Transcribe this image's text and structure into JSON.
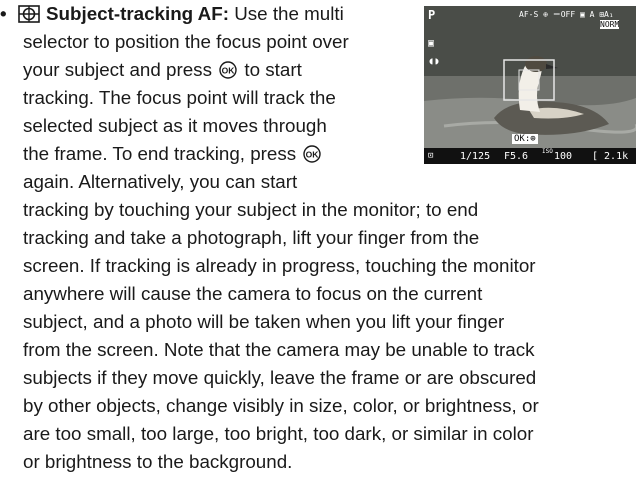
{
  "bullet": {
    "symbol": "•",
    "af_icon": "subject-tracking-af-icon",
    "title": "Subject-tracking AF",
    "title_suffix": ":",
    "ok_icon": "ok-button-icon"
  },
  "lines": [
    " Use the multi",
    "selector to position the focus point over",
    "your subject and press",
    " to start",
    "tracking. The focus point will track the",
    "selected subject as it moves through",
    "the frame. To end tracking, press",
    "again. Alternatively, you can start",
    "tracking by touching your subject in the monitor; to end",
    "tracking and take a photograph, lift your finger from the",
    "screen. If tracking is already in progress, touching the monitor",
    "anywhere will cause the camera to focus on the current",
    "subject, and a photo will be taken when you lift your finger",
    "from the screen. Note that the camera may be unable to track",
    "subjects if they move quickly, leave the frame or are obscured",
    "by other objects, change visibly in size, color, or brightness, or",
    "are too small, too large, too bright, too dark, or similar in color",
    "or brightness to the background."
  ],
  "camera_display": {
    "mode": "P",
    "top_icons": "AF-S ⊕ ＝OFF ▣ A ⊞A₁",
    "picture_control": "NORM",
    "ok_hint": "OK:",
    "shutter": "1/125",
    "aperture": "F5.6",
    "iso_label": "ISO",
    "iso": "100",
    "remaining": "[ 2.1k"
  }
}
